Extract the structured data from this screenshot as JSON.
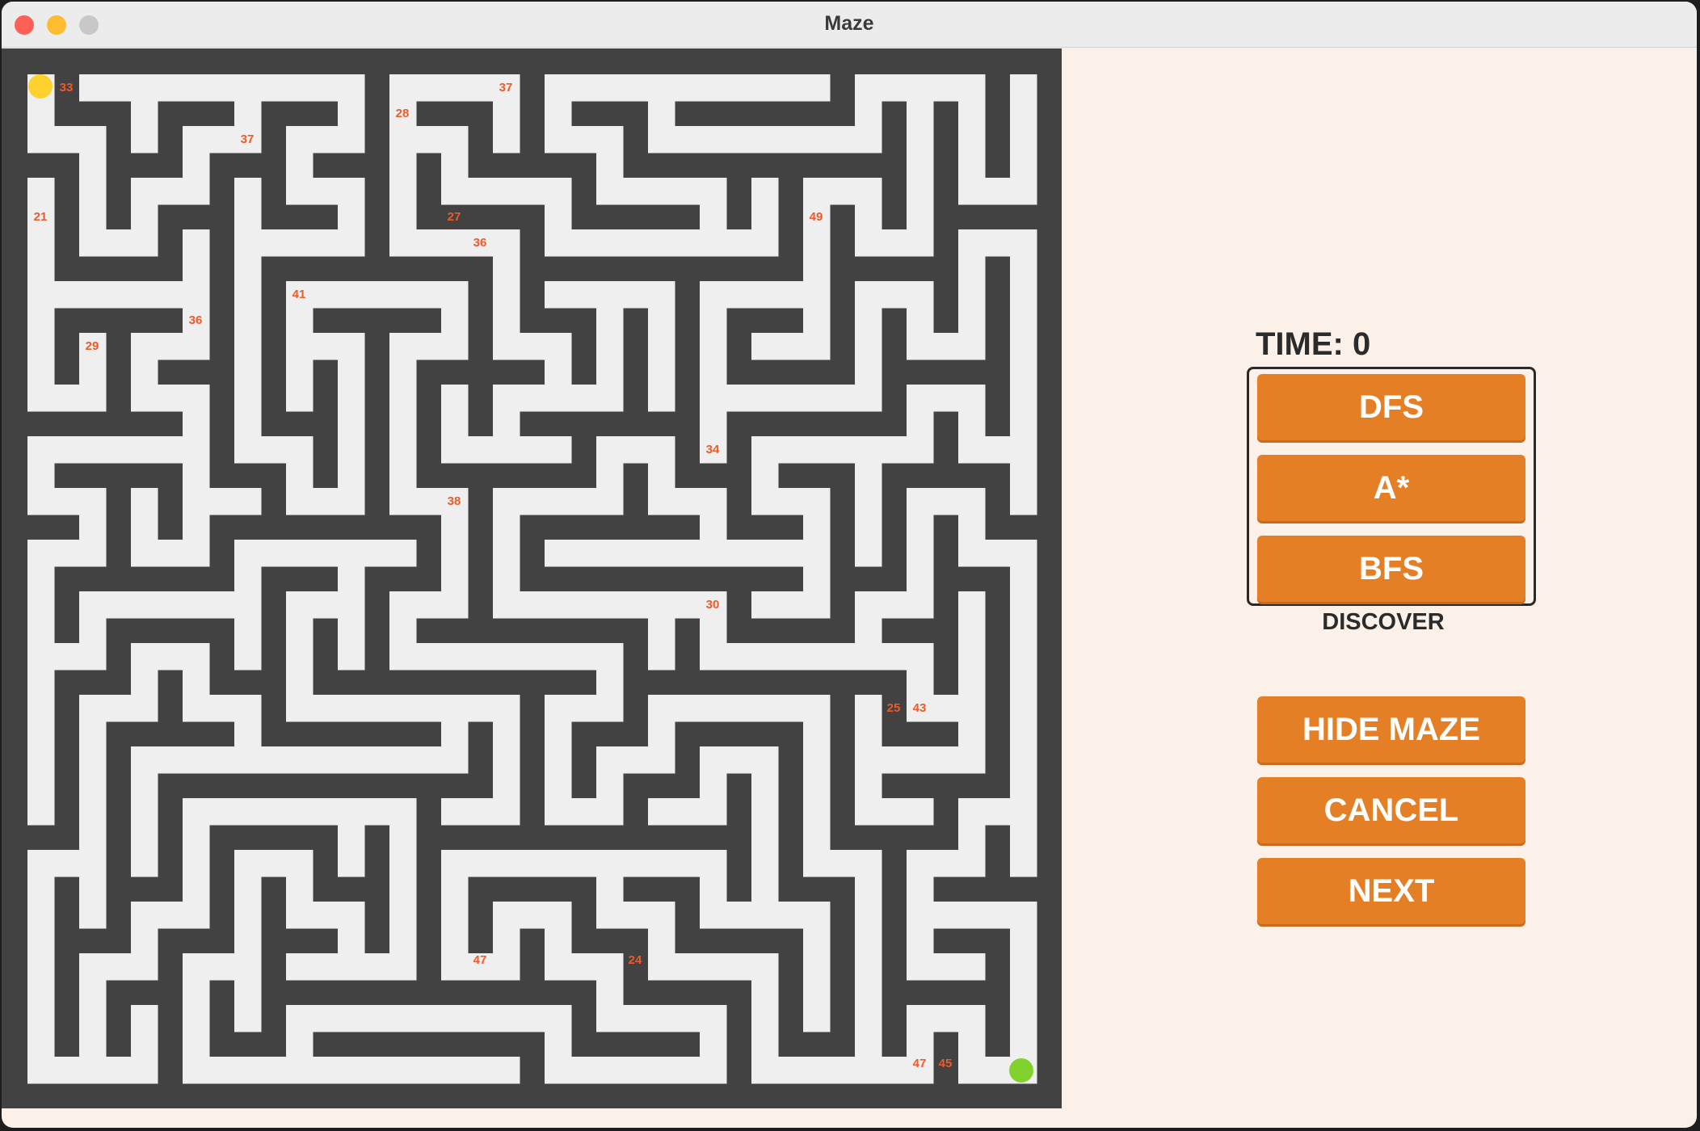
{
  "window": {
    "title": "Maze"
  },
  "maze": {
    "start_color": "#fdd22e",
    "goal_color": "#82d22d",
    "wall_color": "#424242",
    "path_color": "#efefef",
    "cell_labels": [
      "33",
      "37",
      "28",
      "37",
      "21",
      "27",
      "36",
      "49",
      "41",
      "36",
      "29",
      "34",
      "38",
      "30",
      "25",
      "43",
      "47",
      "24",
      "47",
      "45"
    ]
  },
  "panel": {
    "time_label": "TIME: 0",
    "discover_label": "DISCOVER",
    "algorithm_buttons": [
      "DFS",
      "A*",
      "BFS"
    ],
    "hide_maze_label": "HIDE MAZE",
    "cancel_label": "CANCEL",
    "next_label": "NEXT",
    "accent_color": "#e57f26"
  }
}
